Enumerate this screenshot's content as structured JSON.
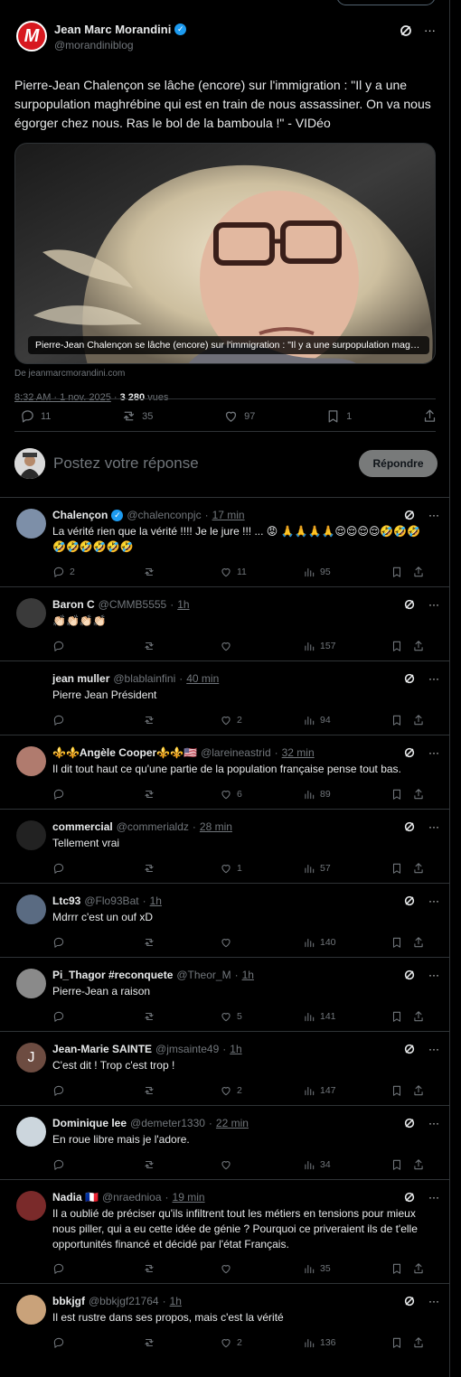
{
  "main_tweet": {
    "author_name": "Jean Marc Morandini",
    "handle": "@morandiniblog",
    "avatar_letter": "M",
    "text": "Pierre-Jean Chalençon se lâche (encore) sur l'immigration : \"Il y a une surpopulation maghrébine qui est en train de nous assassiner. On va nous égorger chez nous. Ras le bol de la bamboula !\" - VIDéo",
    "media_caption": "Pierre-Jean Chalençon se lâche (encore) sur l'immigration : \"Il y a une surpopulation maghrébine qui est en train de nous assassiner",
    "source": "De jeanmarcmorandini.com",
    "time": "8:32 AM · 1 nov. 2025",
    "views_count": "3 280",
    "views_label": "vues",
    "stats": {
      "replies": "11",
      "retweets": "35",
      "likes": "97",
      "bookmarks": "1"
    }
  },
  "reply_box": {
    "placeholder": "Postez votre réponse",
    "button": "Répondre"
  },
  "replies": [
    {
      "name": "Chalençon",
      "verified": true,
      "handle": "@chalenconpjc",
      "time": "17 min",
      "text": "La vérité rien que la vérité !!!! Je le jure !!!  ... 😡 🙏🙏🙏🙏😌😌😌😌🤣🤣🤣🤣🤣🤣🤣🤣🤣",
      "replies": "2",
      "retweets": "",
      "likes": "11",
      "views": "95",
      "avatar": "#7d8fa8"
    },
    {
      "name": "Baron C",
      "verified": false,
      "handle": "@CMMB5555",
      "time": "1h",
      "text": "👏🏻👏🏻👏🏻👏🏻",
      "replies": "",
      "retweets": "",
      "likes": "",
      "views": "157",
      "avatar": "#3a3a3a"
    },
    {
      "name": "jean muller",
      "verified": false,
      "handle": "@blablainfini",
      "time": "40 min",
      "text": "Pierre Jean Président",
      "replies": "",
      "retweets": "",
      "likes": "2",
      "views": "94",
      "avatar": "#000000"
    },
    {
      "name": "⚜️⚜️Angèle Cooper⚜️⚜️🇺🇸",
      "verified": false,
      "handle": "@lareineastrid",
      "time": "32 min",
      "text": "Il dit tout haut ce qu'une partie de la population française pense tout bas.",
      "replies": "",
      "retweets": "",
      "likes": "6",
      "views": "89",
      "avatar": "#b07b6e"
    },
    {
      "name": "commercial",
      "verified": false,
      "handle": "@commerialdz",
      "time": "28 min",
      "text": "Tellement vrai",
      "replies": "",
      "retweets": "",
      "likes": "1",
      "views": "57",
      "avatar": "#222222"
    },
    {
      "name": "Ltc93",
      "verified": false,
      "handle": "@Flo93Bat",
      "time": "1h",
      "text": "Mdrrr c'est un ouf xD",
      "replies": "",
      "retweets": "",
      "likes": "",
      "views": "140",
      "avatar": "#5a6b82"
    },
    {
      "name": "Pi_Thagor #reconquete",
      "verified": false,
      "handle": "@Theor_M",
      "time": "1h",
      "text": "Pierre-Jean a raison",
      "replies": "",
      "retweets": "",
      "likes": "5",
      "views": "141",
      "avatar": "#8a8a8a"
    },
    {
      "name": "Jean-Marie SAINTE",
      "verified": false,
      "handle": "@jmsainte49",
      "time": "1h",
      "text": "C'est dit ! Trop c'est trop !",
      "replies": "",
      "retweets": "",
      "likes": "2",
      "views": "147",
      "avatar": "#6d4c41",
      "avatar_letter": "J"
    },
    {
      "name": "Dominique lee",
      "verified": false,
      "handle": "@demeter1330",
      "time": "22 min",
      "text": "En roue libre mais je l'adore.",
      "replies": "",
      "retweets": "",
      "likes": "",
      "views": "34",
      "avatar": "#ccd6dd"
    },
    {
      "name": "Nadia 🇫🇷",
      "verified": false,
      "handle": "@nraednioa",
      "time": "19 min",
      "text": "Il a oublié de préciser qu'ils infiltrent tout les métiers en tensions pour mieux nous piller, qui a eu cette idée de génie ? Pourquoi ce priveraient ils de t'elle opportunités financé et décidé par l'état Français.",
      "replies": "",
      "retweets": "",
      "likes": "",
      "views": "35",
      "avatar": "#7a2a2a"
    },
    {
      "name": "bbkjgf",
      "verified": false,
      "handle": "@bbkjgf21764",
      "time": "1h",
      "text": "Il est rustre dans ses propos, mais c'est la vérité",
      "replies": "",
      "retweets": "",
      "likes": "2",
      "views": "136",
      "avatar": "#c9a27a"
    }
  ],
  "colors": {
    "background": "#000000",
    "border": "#2f3336",
    "secondary_text": "#71767b",
    "verified": "#1d9bf0",
    "brand_red": "#d71920"
  }
}
